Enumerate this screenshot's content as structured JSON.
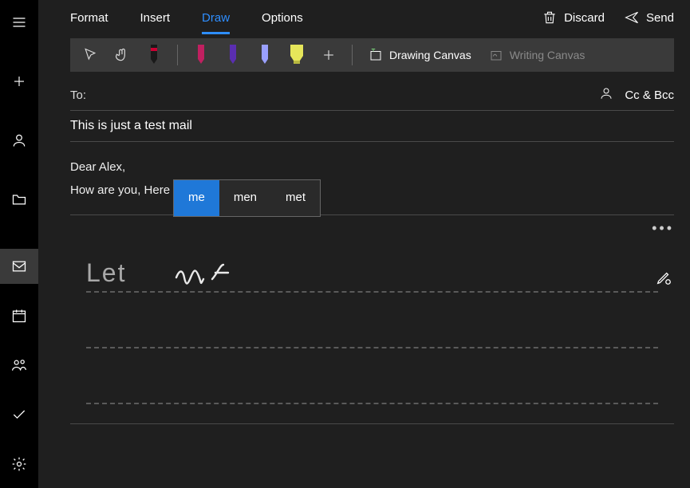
{
  "sidebar": {
    "top_icons": [
      "menu",
      "plus",
      "person",
      "folder"
    ],
    "bottom_icons": [
      "mail",
      "calendar",
      "people",
      "todo",
      "settings"
    ]
  },
  "tabs": {
    "items": [
      {
        "label": "Format"
      },
      {
        "label": "Insert"
      },
      {
        "label": "Draw"
      },
      {
        "label": "Options"
      }
    ],
    "active": 2
  },
  "actions": {
    "discard": "Discard",
    "send": "Send"
  },
  "toolbar": {
    "pens": [
      {
        "fill": "#1a1a1a",
        "band": "#c03",
        "name": "pen-black"
      },
      {
        "fill": "#c02060",
        "band": "#fff",
        "name": "pen-red"
      },
      {
        "fill": "#5a2eb0",
        "band": "#fff",
        "name": "pen-purple"
      },
      {
        "fill": "#9aa0ff",
        "band": "#fff",
        "name": "pen-lilac"
      },
      {
        "fill": "#e6e65a",
        "band": "#fff",
        "name": "highlighter-yellow",
        "wide": true
      }
    ],
    "drawing_canvas": "Drawing Canvas",
    "writing_canvas": "Writing Canvas"
  },
  "compose": {
    "to_label": "To:",
    "ccbcc": "Cc & Bcc",
    "subject": "This is just a test mail",
    "body_lines": [
      "Dear Alex,",
      "How are you, Here is our new business plan."
    ]
  },
  "suggestions": {
    "options": [
      "me",
      "men",
      "met"
    ],
    "selected": 0
  },
  "handwriting": {
    "recognized": "Let"
  }
}
